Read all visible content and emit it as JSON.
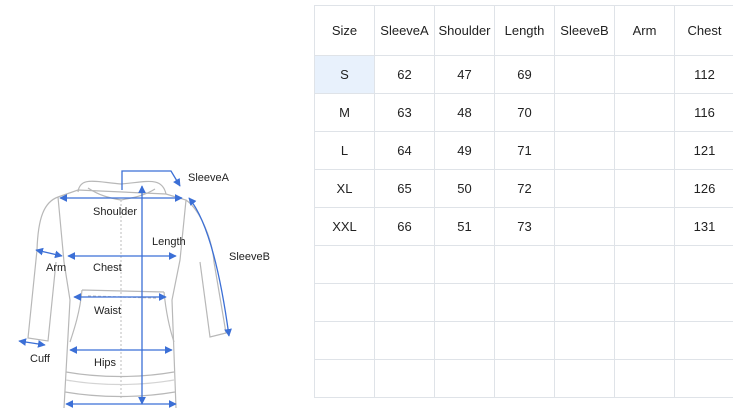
{
  "diagram": {
    "labels": {
      "sleeveA": "SleeveA",
      "sleeveB": "SleeveB",
      "shoulder": "Shoulder",
      "length": "Length",
      "arm": "Arm",
      "chest": "Chest",
      "waist": "Waist",
      "cuff": "Cuff",
      "hips": "Hips"
    },
    "colors": {
      "arrow": "#3b6fd6",
      "outline": "#b8b8b8"
    }
  },
  "table": {
    "headers": [
      "Size",
      "SleeveA",
      "Shoulder",
      "Length",
      "SleeveB",
      "Arm",
      "Chest"
    ],
    "rows": [
      {
        "size": "S",
        "sleeveA": "62",
        "shoulder": "47",
        "length": "69",
        "sleeveB": "",
        "arm": "",
        "chest": "112"
      },
      {
        "size": "M",
        "sleeveA": "63",
        "shoulder": "48",
        "length": "70",
        "sleeveB": "",
        "arm": "",
        "chest": "116"
      },
      {
        "size": "L",
        "sleeveA": "64",
        "shoulder": "49",
        "length": "71",
        "sleeveB": "",
        "arm": "",
        "chest": "121"
      },
      {
        "size": "XL",
        "sleeveA": "65",
        "shoulder": "50",
        "length": "72",
        "sleeveB": "",
        "arm": "",
        "chest": "126"
      },
      {
        "size": "XXL",
        "sleeveA": "66",
        "shoulder": "51",
        "length": "73",
        "sleeveB": "",
        "arm": "",
        "chest": "131"
      }
    ],
    "selected_size": "S",
    "colors": {
      "border": "#dfe3e8",
      "selected_bg": "#e8f1fc"
    }
  }
}
